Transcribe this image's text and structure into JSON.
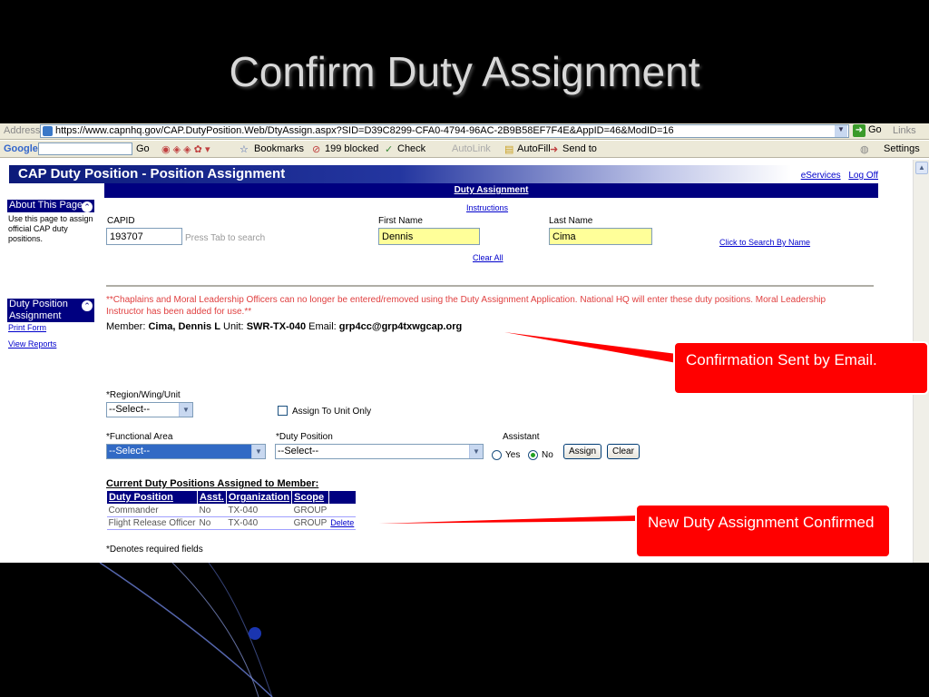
{
  "slide": {
    "title": "Confirm Duty Assignment"
  },
  "browser": {
    "address_label": "Address",
    "url": "https://www.capnhq.gov/CAP.DutyPosition.Web/DtyAssign.aspx?SID=D39C8299-CFA0-4794-96AC-2B9B58EF7F4E&AppID=46&ModID=16",
    "go_label": "Go",
    "links_label": "Links",
    "toolbar": {
      "google": "Google",
      "search_go": "Go",
      "bookmarks": "Bookmarks",
      "blocked": "199 blocked",
      "check": "Check",
      "autolink": "AutoLink",
      "autofill": "AutoFill",
      "send_to": "Send to",
      "settings": "Settings"
    }
  },
  "page": {
    "header_title": "CAP Duty Position - Position Assignment",
    "eservices": "eServices",
    "logoff": "Log Off",
    "subheader": "Duty Assignment",
    "instructions": "Instructions",
    "sidebar": {
      "about_title": "About This Page",
      "about_text": "Use this page to assign official CAP duty positions.",
      "duty_title": "Duty Position Assignment",
      "print_form": "Print Form",
      "view_reports": "View Reports"
    },
    "form": {
      "capid_label": "CAPID",
      "capid_value": "193707",
      "capid_hint": "Press Tab to search",
      "first_name_label": "First Name",
      "first_name_value": "Dennis",
      "last_name_label": "Last Name",
      "last_name_value": "Cima",
      "search_by_name": "Click to Search By Name",
      "clear_all": "Clear All"
    },
    "warning": "**Chaplains and Moral Leadership Officers can no longer be entered/removed using the Duty Assignment Application. National HQ will enter these duty positions. Moral Leadership Instructor has been added for use.**",
    "member": {
      "member_label": "Member:",
      "member_name": "Cima, Dennis L",
      "unit_label": "Unit:",
      "unit_value": "SWR-TX-040",
      "email_label": "Email:",
      "email_value": "grp4cc@grp4txwgcap.org"
    },
    "assign": {
      "region_label": "*Region/Wing/Unit",
      "region_value": "--Select--",
      "assign_unit_only": "Assign To Unit Only",
      "functional_label": "*Functional Area",
      "functional_value": "--Select--",
      "duty_label": "*Duty Position",
      "duty_value": "--Select--",
      "assistant_label": "Assistant",
      "yes": "Yes",
      "no": "No",
      "assistant_selected": "No",
      "assign_btn": "Assign",
      "clear_btn": "Clear"
    },
    "current": {
      "title": "Current Duty Positions Assigned to Member:",
      "columns": [
        "Duty Position",
        "Asst.",
        "Organization",
        "Scope"
      ],
      "rows": [
        {
          "position": "Commander",
          "asst": "No",
          "org": "TX-040",
          "scope": "GROUP",
          "action": ""
        },
        {
          "position": "Flight Release Officer",
          "asst": "No",
          "org": "TX-040",
          "scope": "GROUP",
          "action": "Delete"
        }
      ]
    },
    "required_note": "*Denotes required fields"
  },
  "callouts": {
    "email": "Confirmation Sent by Email.",
    "confirmed": "New Duty Assignment Confirmed"
  },
  "colors": {
    "callout": "#ff0000",
    "header_navy": "#000080",
    "warning_red": "#e04040"
  }
}
